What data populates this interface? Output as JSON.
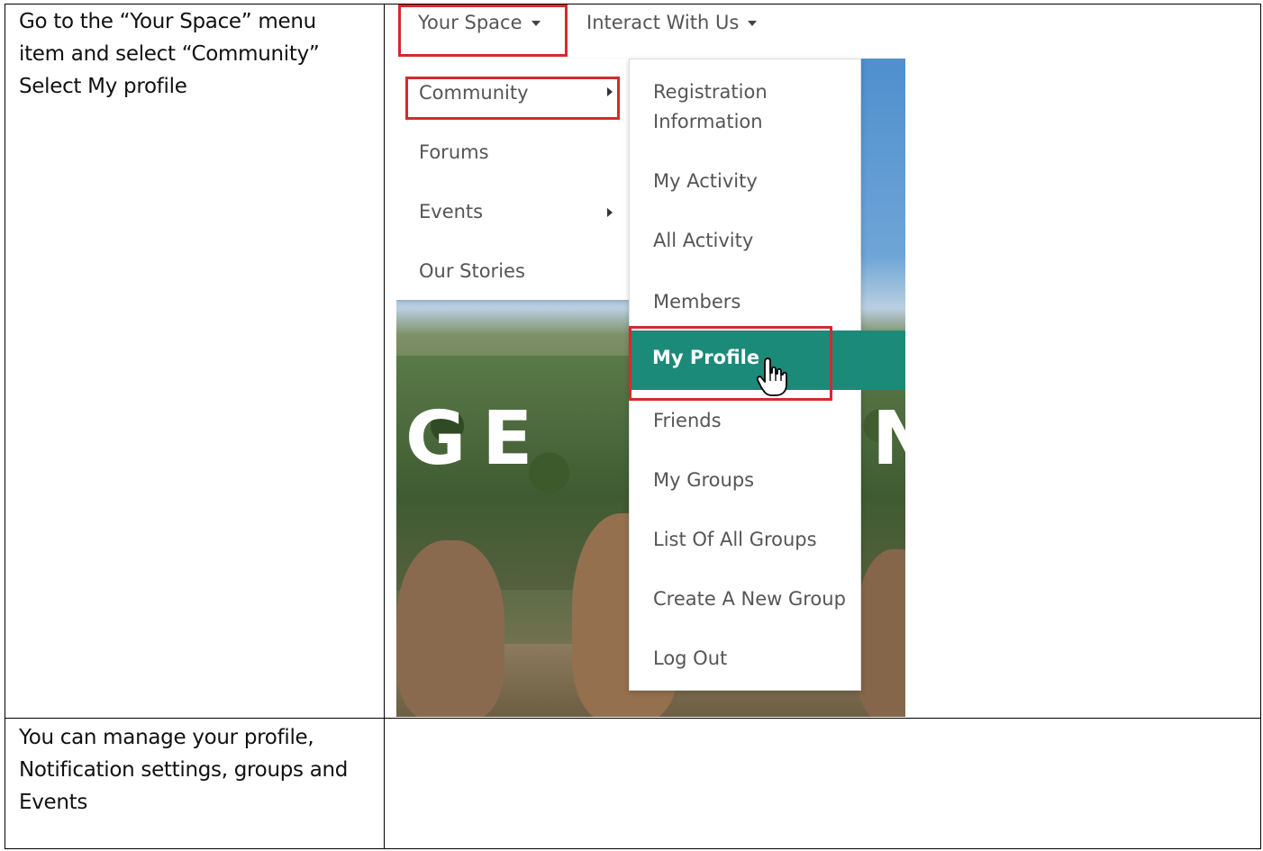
{
  "steps": [
    {
      "instruction": "Go to the “Your Space” menu\nitem and select “Community”\nSelect My profile"
    },
    {
      "instruction": "You can manage your profile,\nNotification settings, groups and\nEvents"
    }
  ],
  "screenshot": {
    "topnav": {
      "your_space": "Your Space",
      "interact_with_us": "Interact With Us"
    },
    "menu1": [
      "Community",
      "Forums",
      "Events",
      "Our Stories"
    ],
    "menu2": {
      "registration_info": "Registration\nInformation",
      "items": [
        "My Activity",
        "All Activity",
        "Members"
      ],
      "active": "My Profile",
      "items_after": [
        "Friends",
        "My Groups",
        "List Of All Groups",
        "Create A New Group",
        "Log Out"
      ]
    },
    "hero_letters_left": "GE",
    "hero_letter_right": "N",
    "highlight_color": "#d62a2a",
    "active_color": "#1c8a78"
  }
}
